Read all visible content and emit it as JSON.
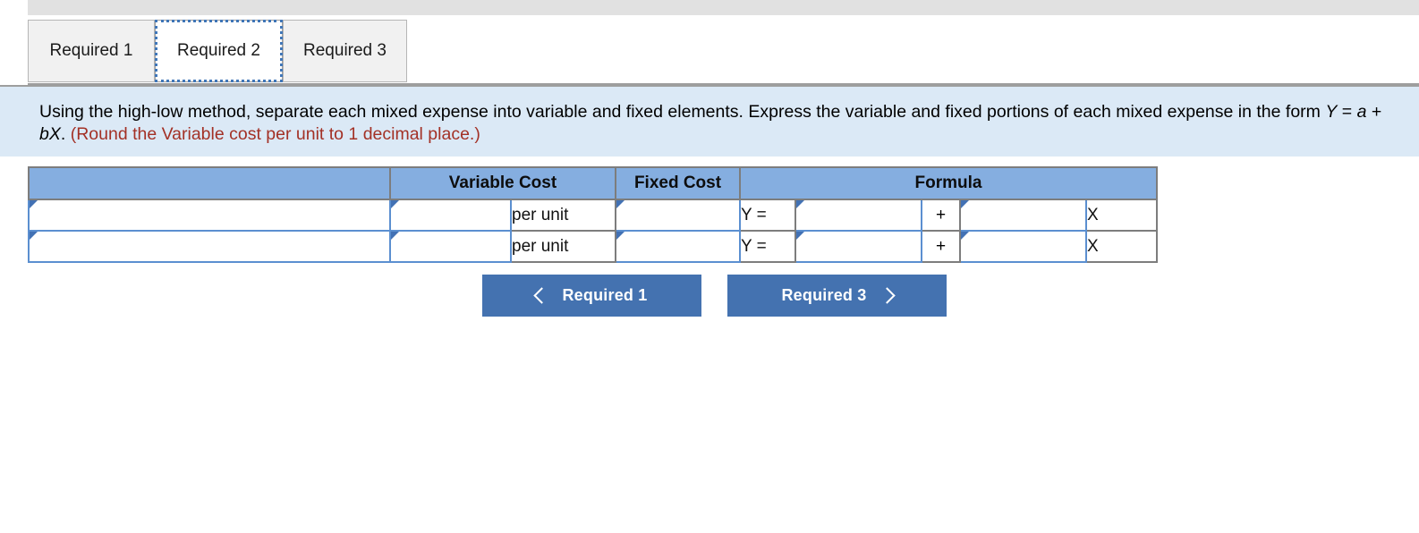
{
  "tabs": [
    {
      "label": "Required 1",
      "active": false
    },
    {
      "label": "Required 2",
      "active": true
    },
    {
      "label": "Required 3",
      "active": false
    }
  ],
  "instruction": {
    "part1": "Using the high-low method, separate each mixed expense into variable and fixed elements. Express the variable and fixed portions of each mixed expense in the form ",
    "formula_y": "Y",
    "eq1": " = ",
    "formula_a": "a",
    "plus": " + ",
    "formula_bx": "bX",
    "period": ". ",
    "note": "(Round the Variable cost per unit to 1 decimal place.)"
  },
  "table": {
    "headers": {
      "name": "",
      "variable_cost": "Variable Cost",
      "fixed_cost": "Fixed Cost",
      "formula": "Formula"
    },
    "rows": [
      {
        "name": "",
        "variable_cost": "",
        "per_unit_label": "per unit",
        "fixed_cost": "",
        "y_equals": "Y =",
        "a_value": "",
        "plus_sign": "+",
        "b_value": "",
        "x_label": "X"
      },
      {
        "name": "",
        "variable_cost": "",
        "per_unit_label": "per unit",
        "fixed_cost": "",
        "y_equals": "Y =",
        "a_value": "",
        "plus_sign": "+",
        "b_value": "",
        "x_label": "X"
      }
    ]
  },
  "navigation": {
    "prev_label": "Required 1",
    "next_label": "Required 3"
  },
  "colors": {
    "header_blue": "#85aee0",
    "button_blue": "#4472b0",
    "panel_blue": "#dbe9f6",
    "note_red": "#a33126",
    "input_border": "#5b8fd0"
  }
}
